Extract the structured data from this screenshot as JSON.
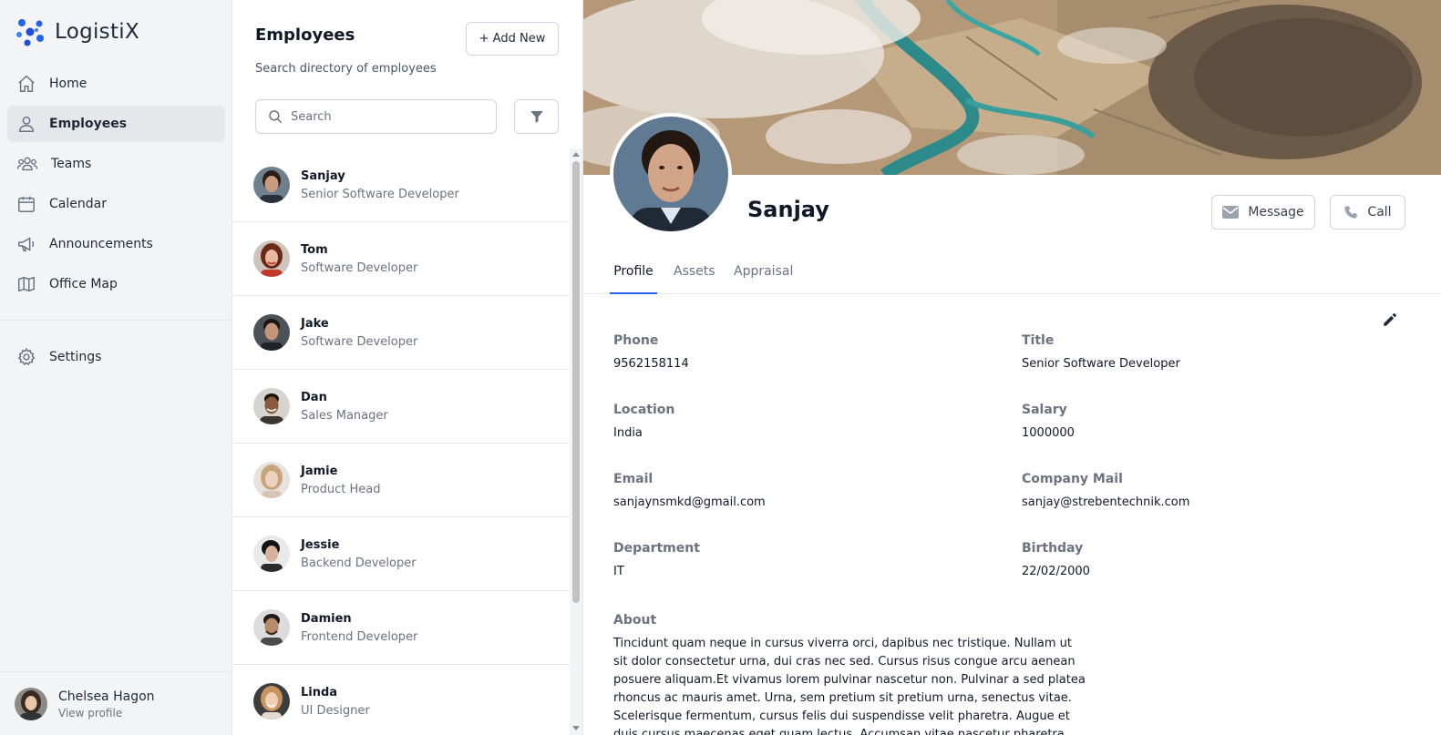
{
  "app": {
    "name": "LogistiX"
  },
  "sidebar": {
    "items": [
      {
        "label": "Home",
        "icon": "home-icon"
      },
      {
        "label": "Employees",
        "icon": "user-icon",
        "active": true
      },
      {
        "label": "Teams",
        "icon": "users-icon"
      },
      {
        "label": "Calendar",
        "icon": "calendar-icon"
      },
      {
        "label": "Announcements",
        "icon": "megaphone-icon"
      },
      {
        "label": "Office Map",
        "icon": "map-icon"
      }
    ],
    "settings": {
      "label": "Settings",
      "icon": "gear-icon"
    },
    "user": {
      "name": "Chelsea Hagon",
      "link": "View profile"
    }
  },
  "directory": {
    "title": "Employees",
    "subtitle": "Search directory of employees",
    "add_label": "+ Add New",
    "search_placeholder": "Search",
    "employees": [
      {
        "name": "Sanjay",
        "role": "Senior Software Developer"
      },
      {
        "name": "Tom",
        "role": "Software Developer"
      },
      {
        "name": "Jake",
        "role": "Software Developer"
      },
      {
        "name": "Dan",
        "role": "Sales Manager"
      },
      {
        "name": "Jamie",
        "role": "Product Head"
      },
      {
        "name": "Jessie",
        "role": "Backend Developer"
      },
      {
        "name": "Damien",
        "role": "Frontend Developer"
      },
      {
        "name": "Linda",
        "role": "UI Designer"
      }
    ]
  },
  "profile": {
    "name": "Sanjay",
    "message_label": "Message",
    "call_label": "Call",
    "tabs": [
      {
        "label": "Profile",
        "active": true
      },
      {
        "label": "Assets"
      },
      {
        "label": "Appraisal"
      }
    ],
    "fields": {
      "phone": {
        "label": "Phone",
        "value": "9562158114"
      },
      "title": {
        "label": "Title",
        "value": "Senior Software Developer"
      },
      "location": {
        "label": "Location",
        "value": "India"
      },
      "salary": {
        "label": "Salary",
        "value": "1000000"
      },
      "email": {
        "label": "Email",
        "value": "sanjaynsmkd@gmail.com"
      },
      "company_mail": {
        "label": "Company Mail",
        "value": "sanjay@strebentechnik.com"
      },
      "department": {
        "label": "Department",
        "value": "IT"
      },
      "birthday": {
        "label": "Birthday",
        "value": "22/02/2000"
      }
    },
    "about": {
      "label": "About",
      "text": "Tincidunt quam neque in cursus viverra orci, dapibus nec tristique. Nullam ut sit dolor consectetur urna, dui cras nec sed. Cursus risus congue arcu aenean posuere aliquam.Et vivamus lorem pulvinar nascetur non. Pulvinar a sed platea rhoncus ac mauris amet. Urna, sem pretium sit pretium urna, senectus vitae. Scelerisque fermentum, cursus felis dui suspendisse velit pharetra. Augue et duis cursus maecenas eget quam lectus. Accumsan vitae nascetur pharetra rhoncus praesent dictum risus suspendisse."
    }
  },
  "colors": {
    "accent": "#2563eb",
    "logo": "#1d4ed8",
    "sidebar_bg": "#f3f4f6"
  }
}
